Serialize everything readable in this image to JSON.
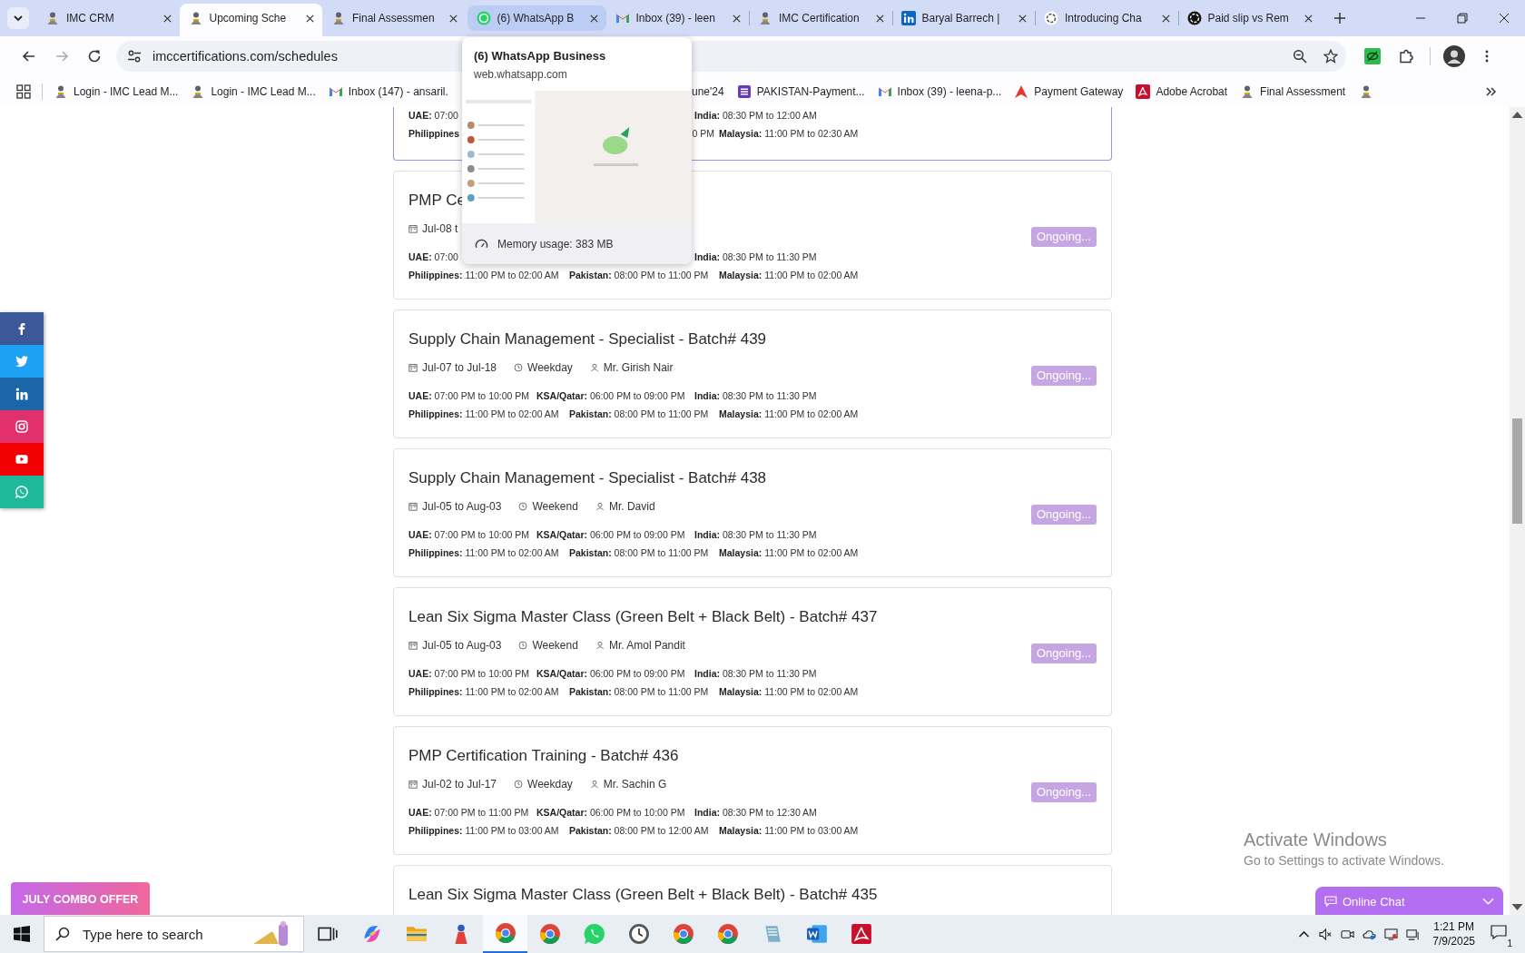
{
  "browser": {
    "tabs": [
      {
        "title": "IMC CRM",
        "kind": "emblem",
        "selected": false,
        "hovered": false
      },
      {
        "title": "Upcoming Sche",
        "kind": "emblem",
        "selected": true,
        "hovered": false
      },
      {
        "title": "Final Assessmen",
        "kind": "emblem",
        "selected": false,
        "hovered": false
      },
      {
        "title": "(6) WhatsApp B",
        "kind": "chat",
        "selected": false,
        "hovered": true
      },
      {
        "title": "Inbox (39) - leen",
        "kind": "mail",
        "selected": false,
        "hovered": false
      },
      {
        "title": "IMC Certification",
        "kind": "emblem",
        "selected": false,
        "hovered": false
      },
      {
        "title": "Baryal Barrech |",
        "kind": "in",
        "selected": false,
        "hovered": false
      },
      {
        "title": "Introducing Cha",
        "kind": "knot",
        "selected": false,
        "hovered": false
      },
      {
        "title": "Paid slip vs Rem",
        "kind": "knot-dark",
        "selected": false,
        "hovered": false
      }
    ],
    "address": "imccertifications.com/schedules",
    "bookmarks": [
      {
        "kind": "emblem",
        "text": "Login - IMC Lead M..."
      },
      {
        "kind": "emblem",
        "text": "Login - IMC Lead M..."
      },
      {
        "kind": "mail",
        "text": "Inbox (147) - ansaril."
      },
      {
        "text": "une'24"
      },
      {
        "kind": "list",
        "text": "PAKISTAN-Payment..."
      },
      {
        "kind": "mail",
        "text": "Inbox (39) - leena-p..."
      },
      {
        "kind": "triangle",
        "text": "Payment Gateway"
      },
      {
        "kind": "pdf",
        "text": "Adobe Acrobat"
      },
      {
        "kind": "emblem",
        "text": "Final Assessment"
      },
      {
        "kind": "emblem"
      }
    ],
    "hover_card": {
      "title": "(6) WhatsApp Business",
      "url": "web.whatsapp.com",
      "memory": "Memory usage: 383 MB"
    }
  },
  "social_links": [
    {
      "kind": "f",
      "color": "#3b5998"
    },
    {
      "kind": "bird",
      "color": "#1da1f2"
    },
    {
      "kind": "in",
      "color": "#1a66a8"
    },
    {
      "kind": "camera",
      "color": "#e1306c"
    },
    {
      "kind": "play",
      "color": "#f20000"
    },
    {
      "kind": "phone",
      "color": "#1eb89a"
    }
  ],
  "schedules": [
    {
      "highlighted": true,
      "rows": [
        [
          {
            "label": "UAE:",
            "time": "07:00"
          },
          null,
          {
            "label": "India:",
            "time": "08:30 PM to 12:00 AM"
          }
        ],
        [
          {
            "label": "Philippines"
          },
          {
            "time": "0 PM"
          },
          {
            "label": "Malaysia:",
            "time": "11:00 PM to 02:30 AM"
          }
        ]
      ]
    },
    {
      "highlighted": false,
      "title": "PMP Ce",
      "date": "Jul-08 t",
      "status": "Ongoing...",
      "rows": [
        [
          {
            "label": "UAE:",
            "time": "07:00"
          },
          null,
          {
            "label": "India:",
            "time": "08:30 PM to 11:30 PM"
          }
        ],
        [
          {
            "label": "Philippines:",
            "time": "11:00 PM to 02:00 AM"
          },
          {
            "label": "Pakistan:",
            "time": "08:00 PM to 11:00 PM"
          },
          {
            "label": "Malaysia:",
            "time": "11:00 PM to 02:00 AM"
          }
        ]
      ]
    },
    {
      "highlighted": false,
      "title": "Supply Chain Management - Specialist - Batch# 439",
      "date": "Jul-07 to Jul-18",
      "weekday": "Weekday",
      "trainer": "Mr. Girish Nair",
      "status": "Ongoing...",
      "rows": [
        [
          {
            "label": "UAE:",
            "time": "07:00 PM to 10:00 PM"
          },
          {
            "label": "KSA/Qatar:",
            "time": "06:00 PM to 09:00 PM"
          },
          {
            "label": "India:",
            "time": "08:30 PM to 11:30 PM"
          }
        ],
        [
          {
            "label": "Philippines:",
            "time": "11:00 PM to 02:00 AM"
          },
          {
            "label": "Pakistan:",
            "time": "08:00 PM to 11:00 PM"
          },
          {
            "label": "Malaysia:",
            "time": "11:00 PM to 02:00 AM"
          }
        ]
      ]
    },
    {
      "highlighted": false,
      "title": "Supply Chain Management - Specialist - Batch# 438",
      "date": "Jul-05 to Aug-03",
      "weekday": "Weekend",
      "trainer": "Mr. David",
      "status": "Ongoing...",
      "rows": [
        [
          {
            "label": "UAE:",
            "time": "07:00 PM to 10:00 PM"
          },
          {
            "label": "KSA/Qatar:",
            "time": "06:00 PM to 09:00 PM"
          },
          {
            "label": "India:",
            "time": "08:30 PM to 11:30 PM"
          }
        ],
        [
          {
            "label": "Philippines:",
            "time": "11:00 PM to 02:00 AM"
          },
          {
            "label": "Pakistan:",
            "time": "08:00 PM to 11:00 PM"
          },
          {
            "label": "Malaysia:",
            "time": "11:00 PM to 02:00 AM"
          }
        ]
      ]
    },
    {
      "highlighted": false,
      "title": "Lean Six Sigma Master Class (Green Belt + Black Belt) - Batch# 437",
      "date": "Jul-05 to Aug-03",
      "weekday": "Weekend",
      "trainer": "Mr. Amol Pandit",
      "status": "Ongoing...",
      "rows": [
        [
          {
            "label": "UAE:",
            "time": "07:00 PM to 10:00 PM"
          },
          {
            "label": "KSA/Qatar:",
            "time": "06:00 PM to 09:00 PM"
          },
          {
            "label": "India:",
            "time": "08:30 PM to 11:30 PM"
          }
        ],
        [
          {
            "label": "Philippines:",
            "time": "11:00 PM to 02:00 AM"
          },
          {
            "label": "Pakistan:",
            "time": "08:00 PM to 11:00 PM"
          },
          {
            "label": "Malaysia:",
            "time": "11:00 PM to 02:00 AM"
          }
        ]
      ]
    },
    {
      "highlighted": false,
      "title": "PMP Certification Training - Batch# 436",
      "date": "Jul-02 to Jul-17",
      "weekday": "Weekday",
      "trainer": "Mr. Sachin G",
      "status": "Ongoing...",
      "rows": [
        [
          {
            "label": "UAE:",
            "time": "07:00 PM to 11:00 PM"
          },
          {
            "label": "KSA/Qatar:",
            "time": "06:00 PM to 10:00 PM"
          },
          {
            "label": "India:",
            "time": "08:30 PM to 12:30 AM"
          }
        ],
        [
          {
            "label": "Philippines:",
            "time": "11:00 PM to 03:00 AM"
          },
          {
            "label": "Pakistan:",
            "time": "08:00 PM to 12:00 AM"
          },
          {
            "label": "Malaysia:",
            "time": "11:00 PM to 03:00 AM"
          }
        ]
      ]
    },
    {
      "highlighted": false,
      "title": "Lean Six Sigma Master Class (Green Belt + Black Belt) - Batch# 435"
    }
  ],
  "combo_offer": "JULY COMBO OFFER",
  "chat_widget": "Online Chat",
  "activation": {
    "title": "Activate Windows",
    "text": "Go to Settings to activate Windows."
  },
  "taskbar": {
    "search_placeholder": "Type here to search",
    "apps": [
      {
        "kind": "taskview",
        "active": false
      },
      {
        "kind": "swirl",
        "active": false
      },
      {
        "kind": "folder",
        "active": false
      },
      {
        "kind": "figure",
        "active": false
      },
      {
        "kind": "browser",
        "active": true
      },
      {
        "kind": "browser",
        "active": false
      },
      {
        "kind": "chat",
        "active": false
      },
      {
        "kind": "clock",
        "active": false
      },
      {
        "kind": "browser",
        "active": false
      },
      {
        "kind": "browser",
        "active": false
      },
      {
        "kind": "notepad",
        "active": false
      },
      {
        "kind": "word",
        "active": false
      },
      {
        "kind": "pdf",
        "active": false
      }
    ],
    "time": "1:21 PM",
    "date": "7/9/2025",
    "notifications": "1"
  }
}
